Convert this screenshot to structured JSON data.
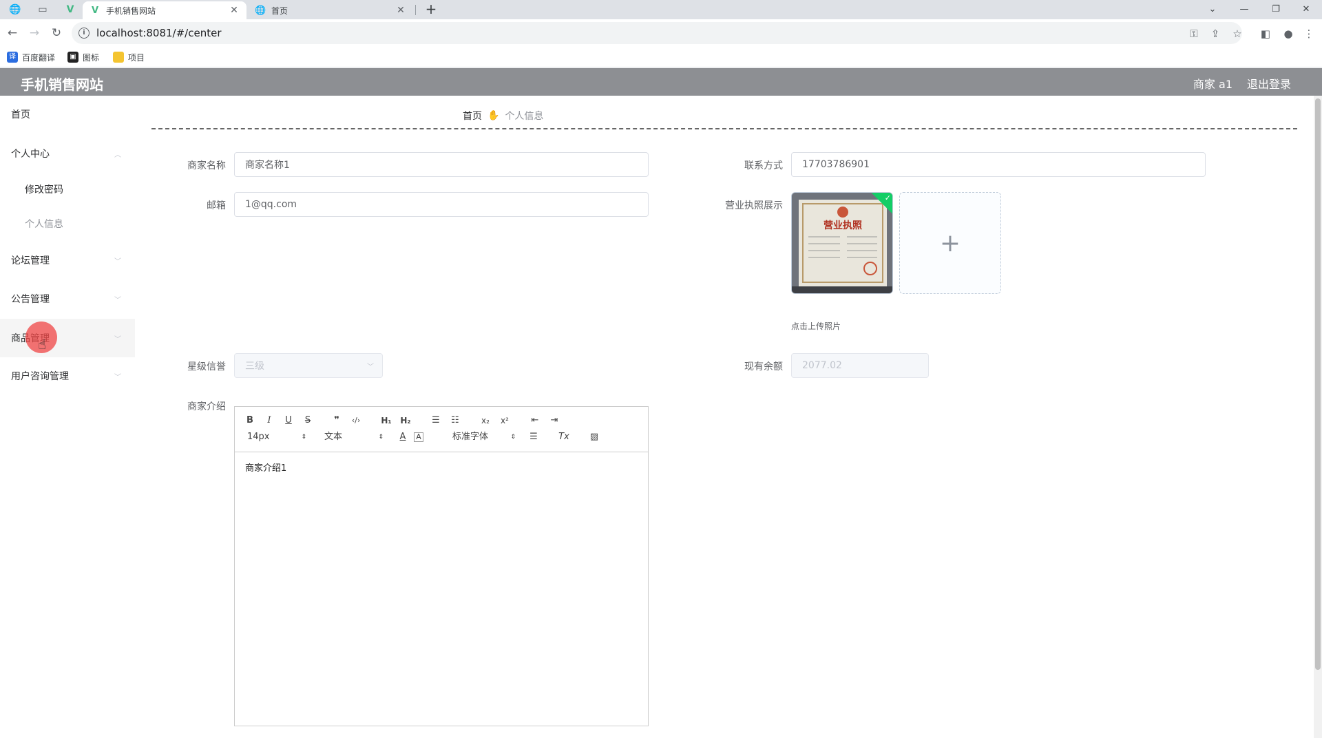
{
  "browser": {
    "tabs": [
      {
        "title": "手机销售网站",
        "active": true
      },
      {
        "title": "首页",
        "active": false
      }
    ],
    "url": "localhost:8081/#/center",
    "bookmarks": [
      "百度翻译",
      "图标",
      "项目"
    ]
  },
  "header": {
    "title": "手机销售网站",
    "user": "商家 a1",
    "logout": "退出登录"
  },
  "sidebar": {
    "items": [
      {
        "label": "首页"
      },
      {
        "label": "个人中心"
      },
      {
        "label": "修改密码"
      },
      {
        "label": "个人信息"
      },
      {
        "label": "论坛管理"
      },
      {
        "label": "公告管理"
      },
      {
        "label": "商品管理"
      },
      {
        "label": "用户咨询管理"
      }
    ]
  },
  "breadcrumb": {
    "home": "首页",
    "current": "个人信息"
  },
  "form": {
    "merchant_name": {
      "label": "商家名称",
      "value": "商家名称1"
    },
    "contact": {
      "label": "联系方式",
      "value": "17703786901"
    },
    "email": {
      "label": "邮箱",
      "value": "1@qq.com"
    },
    "license": {
      "label": "营业执照展示",
      "upload_tip": "点击上传照片"
    },
    "rating": {
      "label": "星级信誉",
      "value": "三级"
    },
    "balance": {
      "label": "现有余额",
      "value": "2077.02"
    },
    "intro": {
      "label": "商家介绍",
      "content": "商家介绍1",
      "font_size": "14px",
      "block_type": "文本",
      "font_family": "标准字体"
    }
  },
  "colors": {
    "header_bg": "#8d8f93",
    "success": "#13ce66"
  }
}
